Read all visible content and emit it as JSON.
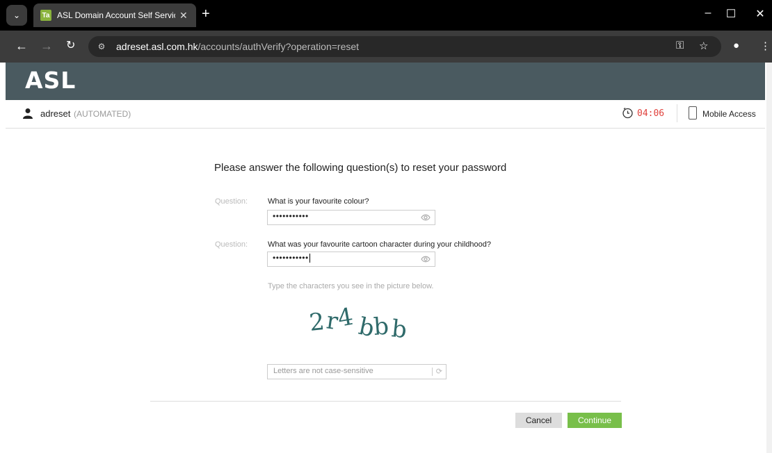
{
  "browser": {
    "tab_title": "ASL Domain Account Self Servic",
    "favicon_text": "Ta",
    "url_host": "adreset.asl.com.hk",
    "url_path": "/accounts/authVerify?operation=reset",
    "icons": [
      "tab-search-icon",
      "close-icon",
      "new-tab-icon",
      "minimize-icon",
      "maximize-icon",
      "close-window-icon",
      "back-icon",
      "forward-icon",
      "reload-icon",
      "site-info-icon",
      "key-icon",
      "star-icon",
      "profile-icon",
      "menu-icon"
    ]
  },
  "header": {
    "logo": "ASL",
    "brand_color": "#4a5a60"
  },
  "userbar": {
    "username": "adreset",
    "role": "(AUTOMATED)",
    "timer": "04:06",
    "timer_color": "#e0413c",
    "mobile_access": "Mobile Access"
  },
  "form": {
    "title": "Please answer the following question(s) to reset your password",
    "questions": [
      {
        "label": "Question:",
        "text": "What is your favourite colour?",
        "masked_value": "•••••••••••"
      },
      {
        "label": "Question:",
        "text": "What was your favourite cartoon character during your childhood?",
        "masked_value": "•••••••••••"
      }
    ],
    "captcha_hint": "Type the characters you see in the picture below.",
    "captcha_text": "2r4bbb",
    "captcha_placeholder": "Letters are not case-sensitive",
    "cancel_label": "Cancel",
    "continue_label": "Continue",
    "continue_color": "#78bf4a"
  }
}
